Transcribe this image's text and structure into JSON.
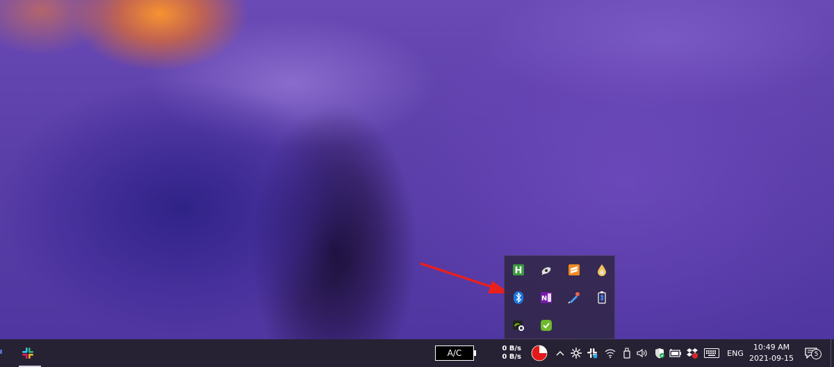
{
  "taskbar": {
    "battery_label": "A/C",
    "net_speed_up": "0 B/s",
    "net_speed_down": "0 B/s",
    "language": "ENG",
    "clock_time": "10:49 AM",
    "clock_date": "2021-09-15",
    "notification_count": "5"
  },
  "tray_overflow": {
    "icons": [
      "hwmonitor-icon",
      "radar-satellite-icon",
      "sublime-text-icon",
      "ink-drop-icon",
      "bluetooth-icon",
      "onenote-icon",
      "mail-rocket-icon",
      "bluetooth-battery-icon",
      "nvidia-icon",
      "green-check-icon"
    ]
  },
  "annotation": {
    "arrow_color": "#e8201e"
  },
  "colors": {
    "taskbar_bg": "#262233",
    "tray_bg": "#30264a"
  }
}
